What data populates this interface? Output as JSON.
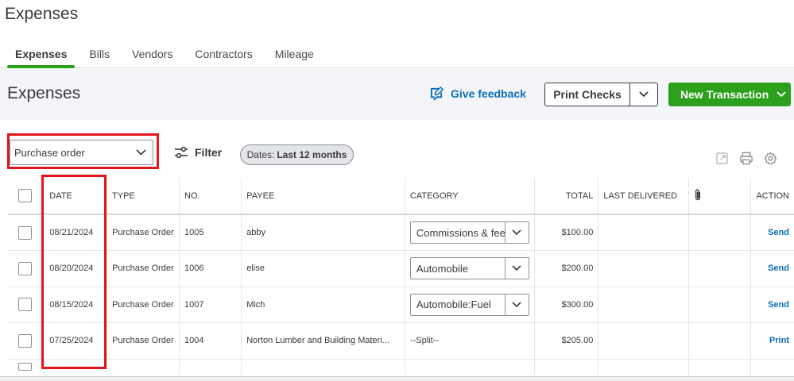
{
  "app": {
    "title": "Expenses"
  },
  "tabs": [
    {
      "label": "Expenses",
      "active": true
    },
    {
      "label": "Bills",
      "active": false
    },
    {
      "label": "Vendors",
      "active": false
    },
    {
      "label": "Contractors",
      "active": false
    },
    {
      "label": "Mileage",
      "active": false
    }
  ],
  "section": {
    "title": "Expenses"
  },
  "toolbar": {
    "feedback_label": "Give feedback",
    "print_checks_label": "Print Checks",
    "new_transaction_label": "New Transaction"
  },
  "filters": {
    "type_select_value": "Purchase order",
    "filter_label": "Filter",
    "date_chip_prefix": "Dates:",
    "date_chip_value": "Last 12 months"
  },
  "table": {
    "headers": {
      "date": "DATE",
      "type": "TYPE",
      "no": "NO.",
      "payee": "PAYEE",
      "category": "CATEGORY",
      "total": "TOTAL",
      "last_delivered": "LAST DELIVERED",
      "action": "ACTION"
    },
    "rows": [
      {
        "date": "08/21/2024",
        "type": "Purchase Order",
        "no": "1005",
        "payee": "abby",
        "category": "Commissions & fees",
        "category_select": true,
        "total": "$100.00",
        "action": "Send"
      },
      {
        "date": "08/20/2024",
        "type": "Purchase Order",
        "no": "1006",
        "payee": "elise",
        "category": "Automobile",
        "category_select": true,
        "total": "$200.00",
        "action": "Send"
      },
      {
        "date": "08/15/2024",
        "type": "Purchase Order",
        "no": "1007",
        "payee": "Mich",
        "category": "Automobile:Fuel",
        "category_select": true,
        "total": "$300.00",
        "action": "Send"
      },
      {
        "date": "07/25/2024",
        "type": "Purchase Order",
        "no": "1004",
        "payee": "Norton Lumber and Building Materi...",
        "category": "--Split--",
        "category_select": false,
        "total": "$205.00",
        "action": "Print"
      }
    ]
  },
  "colors": {
    "accent_green": "#2ca01c",
    "link_blue": "#0d6fb8",
    "highlight_red": "#e5161c",
    "text": "#393a3d"
  },
  "icons": [
    "feedback-icon",
    "chevron-down-icon",
    "filter-sliders-icon",
    "export-icon",
    "print-icon",
    "settings-gear-icon",
    "attachment-paperclip-icon"
  ]
}
